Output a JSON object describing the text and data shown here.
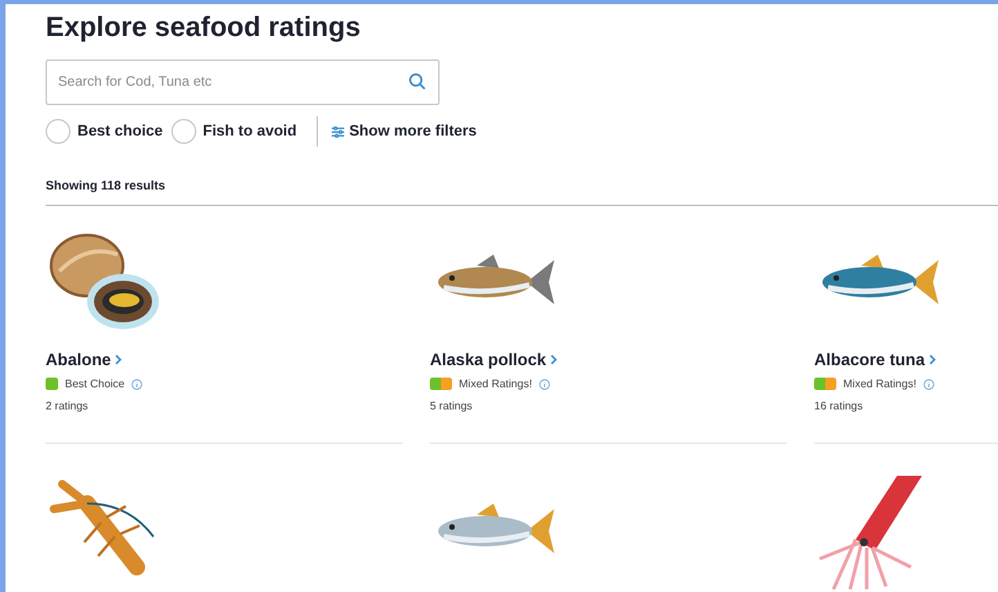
{
  "title": "Explore seafood ratings",
  "search": {
    "placeholder": "Search for Cod, Tuna etc"
  },
  "filters": [
    {
      "label": "Best choice",
      "selected": false
    },
    {
      "label": "Fish to avoid",
      "selected": false
    }
  ],
  "more_filters": "Show more filters",
  "results_count": "Showing 118 results",
  "cards": [
    {
      "kind": "abalone",
      "name": "Abalone",
      "rating": {
        "kind": "best",
        "label": "Best Choice"
      },
      "count": "2 ratings"
    },
    {
      "kind": "pollock",
      "name": "Alaska pollock",
      "rating": {
        "kind": "mixed",
        "label": "Mixed Ratings!"
      },
      "count": "5 ratings"
    },
    {
      "kind": "tuna",
      "name": "Albacore tuna",
      "rating": {
        "kind": "mixed",
        "label": "Mixed Ratings!"
      },
      "count": "16 ratings"
    },
    {
      "kind": "lobster"
    },
    {
      "kind": "salmon"
    },
    {
      "kind": "squid"
    }
  ]
}
